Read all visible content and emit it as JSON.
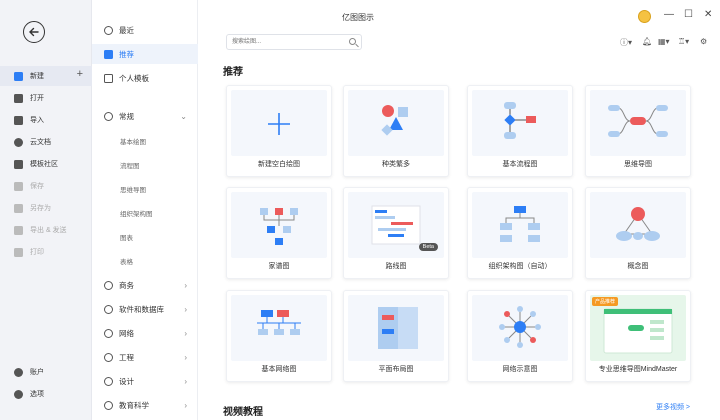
{
  "app": {
    "title": "亿图图示"
  },
  "rail": {
    "items": [
      {
        "label": "新建",
        "icon": "new-icon"
      },
      {
        "label": "打开",
        "icon": "folder-icon"
      },
      {
        "label": "导入",
        "icon": "import-icon"
      },
      {
        "label": "云文档",
        "icon": "cloud-icon"
      },
      {
        "label": "模板社区",
        "icon": "community-icon"
      },
      {
        "label": "保存",
        "icon": "save-icon"
      },
      {
        "label": "另存为",
        "icon": "save-as-icon"
      },
      {
        "label": "导出 & 发送",
        "icon": "export-icon"
      },
      {
        "label": "打印",
        "icon": "print-icon"
      },
      {
        "label": "账户",
        "icon": "account-icon"
      },
      {
        "label": "选项",
        "icon": "options-icon"
      }
    ]
  },
  "categories": {
    "recent": "最近",
    "recommend": "推荐",
    "personal": "个人模板",
    "general": "常规",
    "general_subs": [
      "基本绘图",
      "流程图",
      "思维导图",
      "组织架构图",
      "图表",
      "表格"
    ],
    "groups": [
      "商务",
      "软件和数据库",
      "网络",
      "工程",
      "设计",
      "教育科学"
    ]
  },
  "search": {
    "placeholder": "搜索绘图..."
  },
  "main": {
    "recommend_title": "推荐",
    "video_title": "视频教程",
    "more_videos": "更多视频 >"
  },
  "cards": [
    {
      "label": "新建空白绘图",
      "kind": "blank"
    },
    {
      "label": "种类繁多",
      "kind": "shapes"
    },
    {
      "label": "基本流程图",
      "kind": "flow"
    },
    {
      "label": "思维导图",
      "kind": "mind"
    },
    {
      "label": "家谱图",
      "kind": "family"
    },
    {
      "label": "路线图",
      "kind": "roadmap",
      "badge": "Beta"
    },
    {
      "label": "组织架构图（自动）",
      "kind": "org"
    },
    {
      "label": "概念图",
      "kind": "concept"
    },
    {
      "label": "基本网络图",
      "kind": "network"
    },
    {
      "label": "平面布局图",
      "kind": "floor"
    },
    {
      "label": "网络示意图",
      "kind": "netdiag"
    },
    {
      "label": "专业思维导图MindMaster",
      "kind": "promo",
      "badge": "产品推荐"
    }
  ],
  "colors": {
    "accent": "#2d7ef5",
    "red": "#ec5b5b",
    "lightblue": "#aecdf0"
  }
}
